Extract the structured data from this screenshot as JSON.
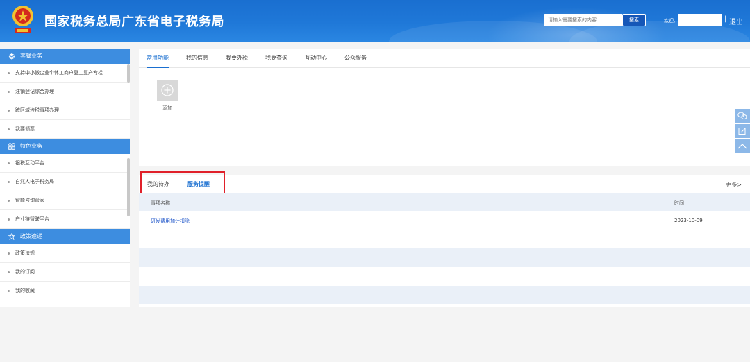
{
  "header": {
    "title": "国家税务总局广东省电子税务局",
    "search_placeholder": "请输入需要搜索的内容",
    "search_button": "搜索",
    "welcome": "欢迎,",
    "separator": "|",
    "logout": "退出"
  },
  "sidebar": {
    "sections": [
      {
        "title": "套餐业务",
        "icon": "layers-icon",
        "items": [
          "支持中小微企业个体工商户复工复产专栏",
          "注销登记综合办理",
          "跨区域涉税事项办理",
          "我要领票"
        ]
      },
      {
        "title": "特色业务",
        "icon": "grid-icon",
        "items": [
          "银税互动平台",
          "自然人电子税务局",
          "智能咨询管家",
          "产业链智联平台"
        ]
      },
      {
        "title": "政策速递",
        "icon": "star-icon",
        "items": [
          "政策法规",
          "我的订阅",
          "我的收藏"
        ]
      }
    ]
  },
  "main": {
    "tabs": [
      "常用功能",
      "我的信息",
      "我要办税",
      "我要查询",
      "互动中心",
      "公众服务"
    ],
    "active_tab": 0,
    "add_label": "添加"
  },
  "todo": {
    "tabs": [
      "我的待办",
      "服务提醒"
    ],
    "active_tab": 1,
    "more": "更多>",
    "columns": [
      "事项名称",
      "时间"
    ],
    "rows": [
      {
        "name": "研发费用加计扣除",
        "time": "2023-10-09"
      }
    ]
  },
  "colors": {
    "header_blue": "#1f78d8",
    "sidebar_header": "#3d8de0",
    "active_link": "#1a6fd0",
    "highlight_border": "#e0202a"
  }
}
